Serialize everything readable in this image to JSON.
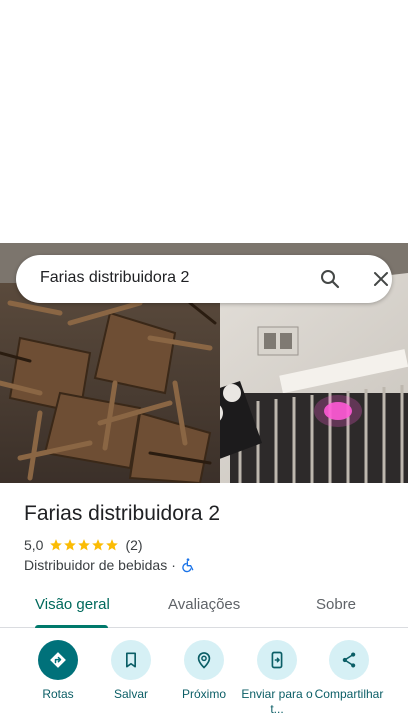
{
  "search": {
    "query": "Farias distribuidora 2"
  },
  "place": {
    "name": "Farias distribuidora 2",
    "rating": "5,0",
    "stars": 5,
    "reviews": "(2)",
    "category": "Distribuidor de bebidas",
    "separator": "·"
  },
  "tabs": [
    {
      "label": "Visão geral",
      "active": true
    },
    {
      "label": "Avaliações",
      "active": false
    },
    {
      "label": "Sobre",
      "active": false
    }
  ],
  "actions": [
    {
      "label": "Rotas",
      "icon": "directions-icon"
    },
    {
      "label": "Salvar",
      "icon": "bookmark-icon"
    },
    {
      "label": "Próximo",
      "icon": "nearby-icon"
    },
    {
      "label": "Enviar para o t...",
      "icon": "send-to-phone-icon"
    },
    {
      "label": "Compartilhar",
      "icon": "share-icon"
    }
  ],
  "colors": {
    "accent": "#00717a",
    "accent_light": "#d6f0f5",
    "star": "#fbbc04",
    "tab_active": "#00695c"
  }
}
